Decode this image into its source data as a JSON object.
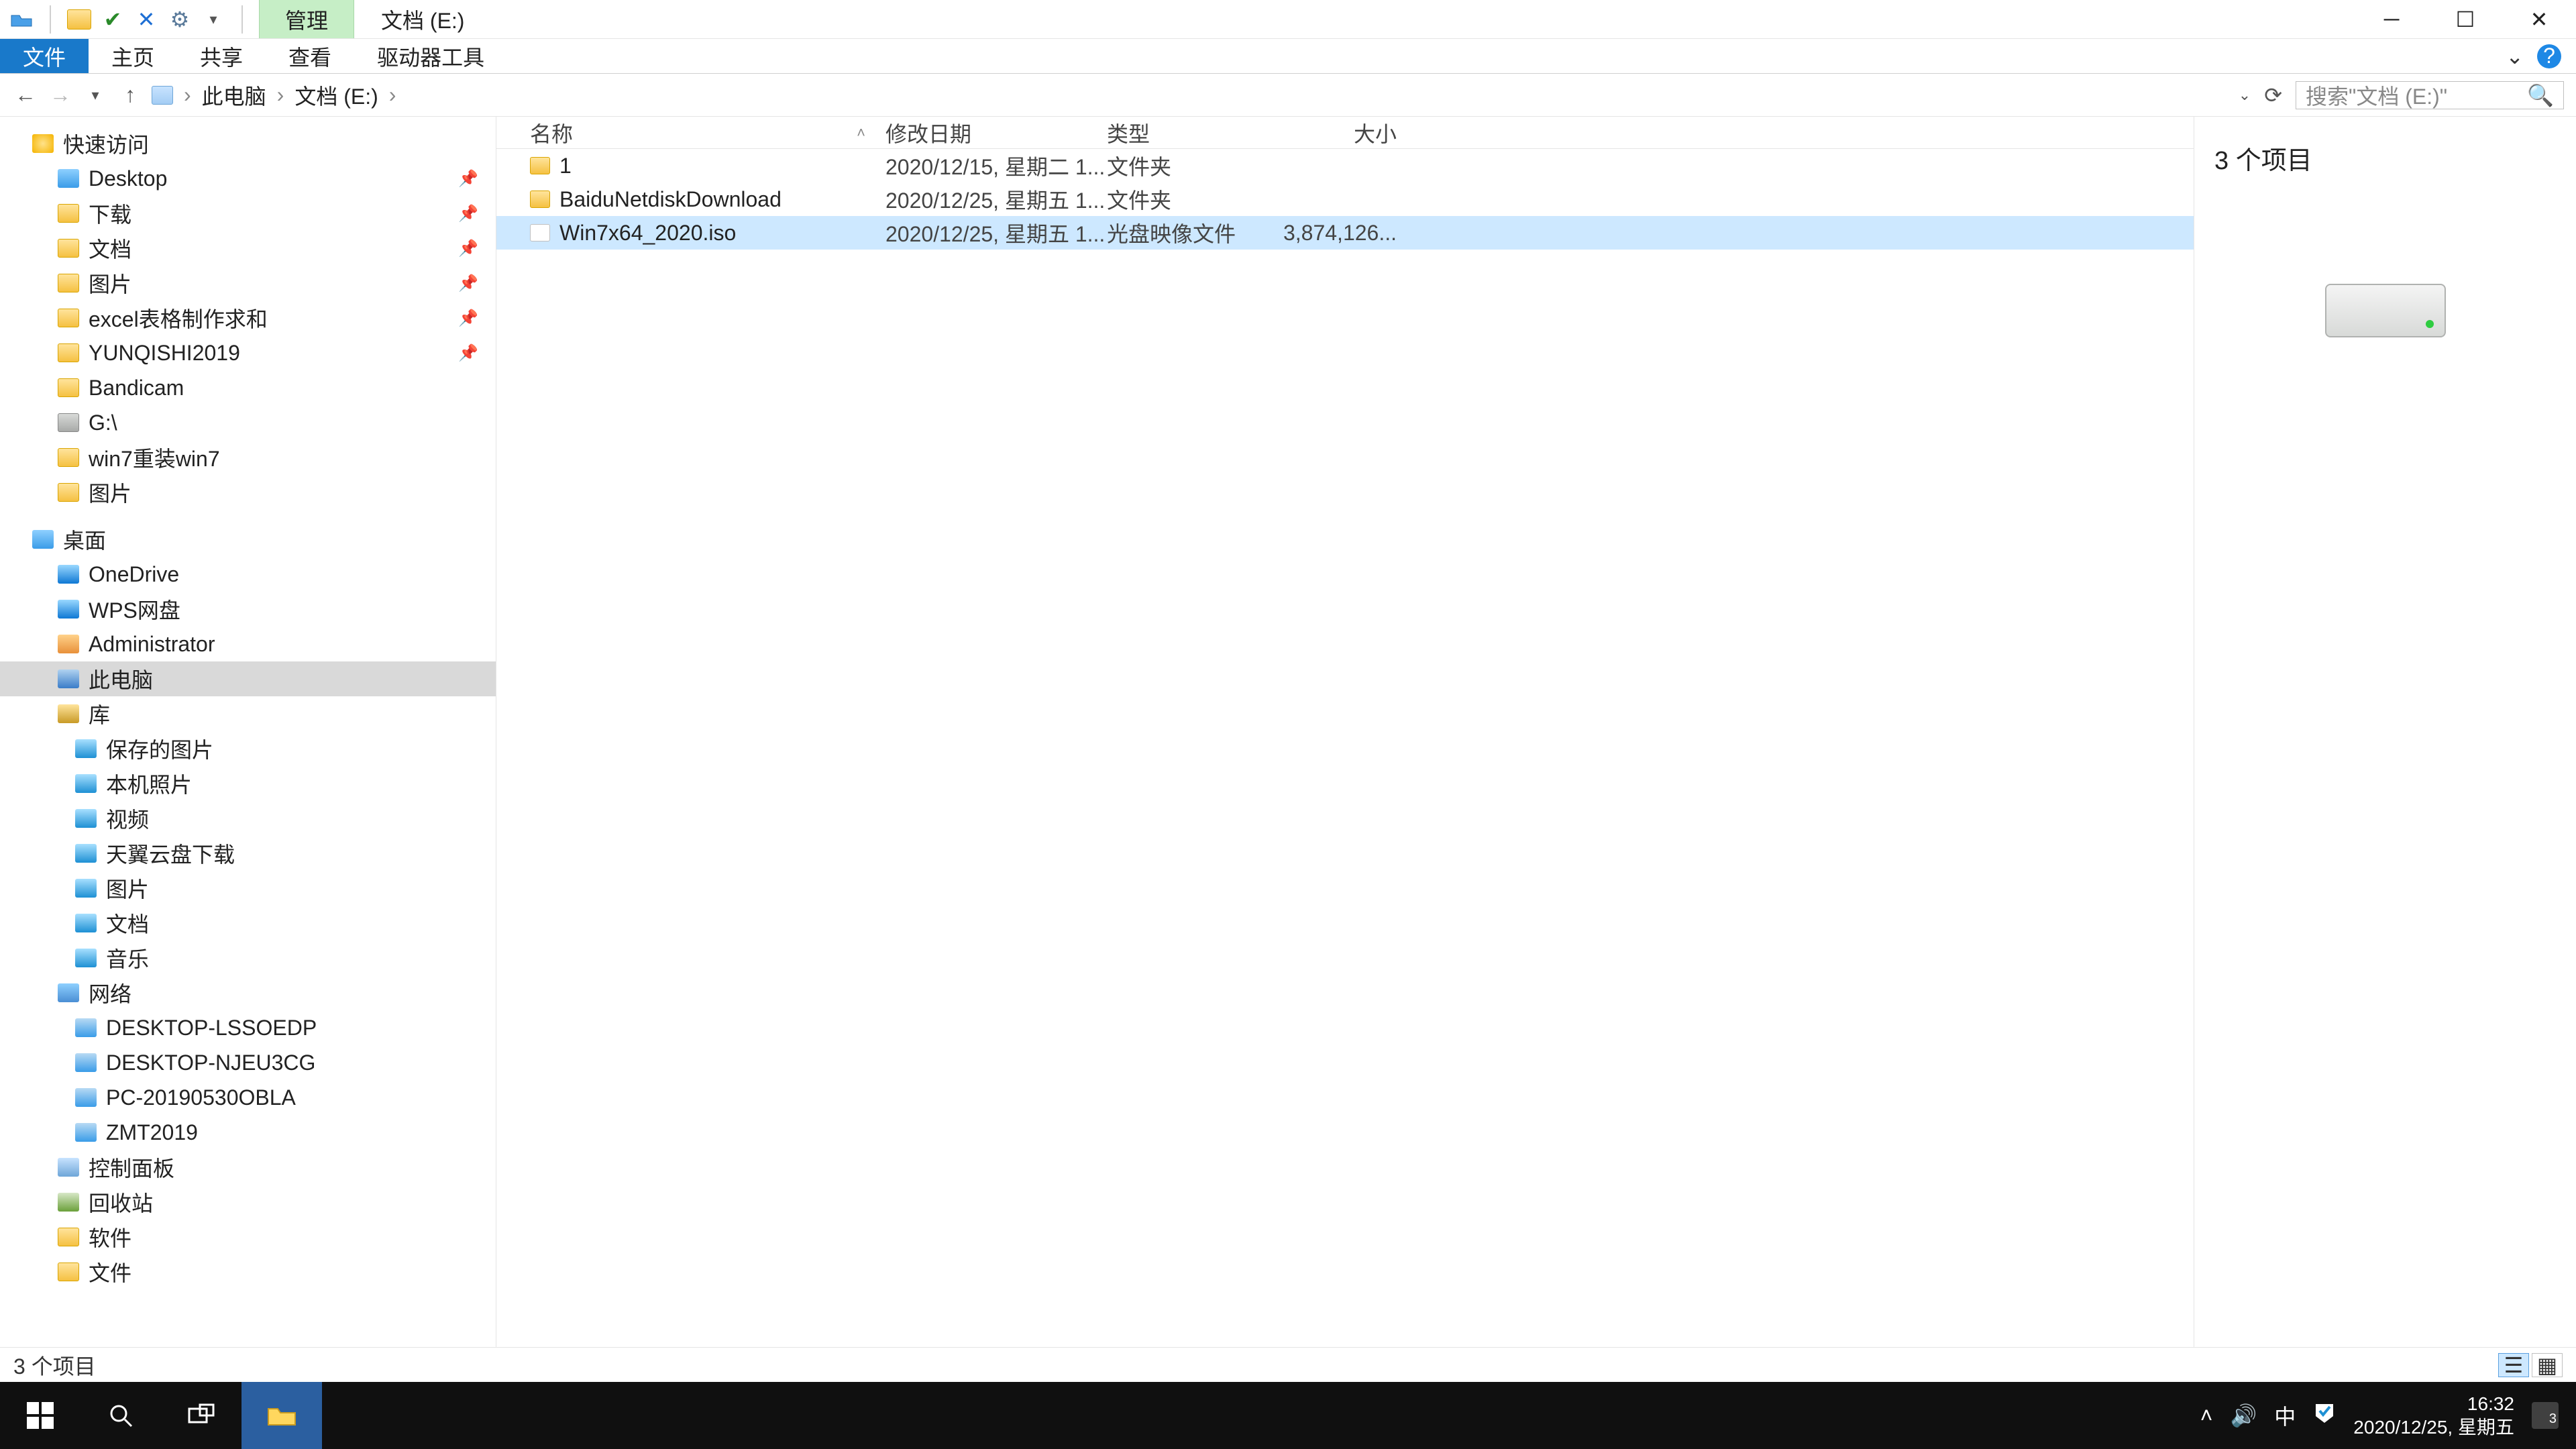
{
  "title": {
    "ribbon_ctx_tab": "管理",
    "caption": "文档 (E:)"
  },
  "ribbon": {
    "file": "文件",
    "home": "主页",
    "share": "共享",
    "view": "查看",
    "drive_tools": "驱动器工具"
  },
  "breadcrumb": {
    "this_pc": "此电脑",
    "drive": "文档 (E:)"
  },
  "search": {
    "placeholder": "搜索\"文档 (E:)\""
  },
  "columns": {
    "name": "名称",
    "date": "修改日期",
    "type": "类型",
    "size": "大小"
  },
  "files": [
    {
      "name": "1",
      "date": "2020/12/15, 星期二 1...",
      "type": "文件夹",
      "size": "",
      "kind": "folder",
      "selected": false
    },
    {
      "name": "BaiduNetdiskDownload",
      "date": "2020/12/25, 星期五 1...",
      "type": "文件夹",
      "size": "",
      "kind": "folder",
      "selected": false
    },
    {
      "name": "Win7x64_2020.iso",
      "date": "2020/12/25, 星期五 1...",
      "type": "光盘映像文件",
      "size": "3,874,126...",
      "kind": "iso",
      "selected": true
    }
  ],
  "preview": {
    "summary": "3 个项目"
  },
  "status": {
    "text": "3 个项目"
  },
  "tree": {
    "quick_access": "快速访问",
    "pinned": [
      {
        "label": "Desktop",
        "icon": "desktop"
      },
      {
        "label": "下载",
        "icon": "folder"
      },
      {
        "label": "文档",
        "icon": "folder"
      },
      {
        "label": "图片",
        "icon": "folder"
      },
      {
        "label": "excel表格制作求和",
        "icon": "folder"
      },
      {
        "label": "YUNQISHI2019",
        "icon": "folder"
      },
      {
        "label": "Bandicam",
        "icon": "folder"
      },
      {
        "label": "G:\\",
        "icon": "drive"
      },
      {
        "label": "win7重装win7",
        "icon": "folder"
      },
      {
        "label": "图片",
        "icon": "folder"
      }
    ],
    "desktop_root": "桌面",
    "onedrive": "OneDrive",
    "wps": "WPS网盘",
    "admin": "Administrator",
    "this_pc": "此电脑",
    "libraries": "库",
    "lib_items": [
      {
        "label": "保存的图片",
        "icon": "lib-pic"
      },
      {
        "label": "本机照片",
        "icon": "lib-pic"
      },
      {
        "label": "视频",
        "icon": "lib-pic"
      },
      {
        "label": "天翼云盘下载",
        "icon": "lib-pic"
      },
      {
        "label": "图片",
        "icon": "lib-pic"
      },
      {
        "label": "文档",
        "icon": "lib-pic"
      },
      {
        "label": "音乐",
        "icon": "lib-pic"
      }
    ],
    "network": "网络",
    "net_items": [
      "DESKTOP-LSSOEDP",
      "DESKTOP-NJEU3CG",
      "PC-20190530OBLA",
      "ZMT2019"
    ],
    "control_panel": "控制面板",
    "recycle": "回收站",
    "software": "软件",
    "documents": "文件"
  },
  "taskbar": {
    "time": "16:32",
    "date": "2020/12/25, 星期五",
    "ime": "中",
    "badge": "3"
  }
}
